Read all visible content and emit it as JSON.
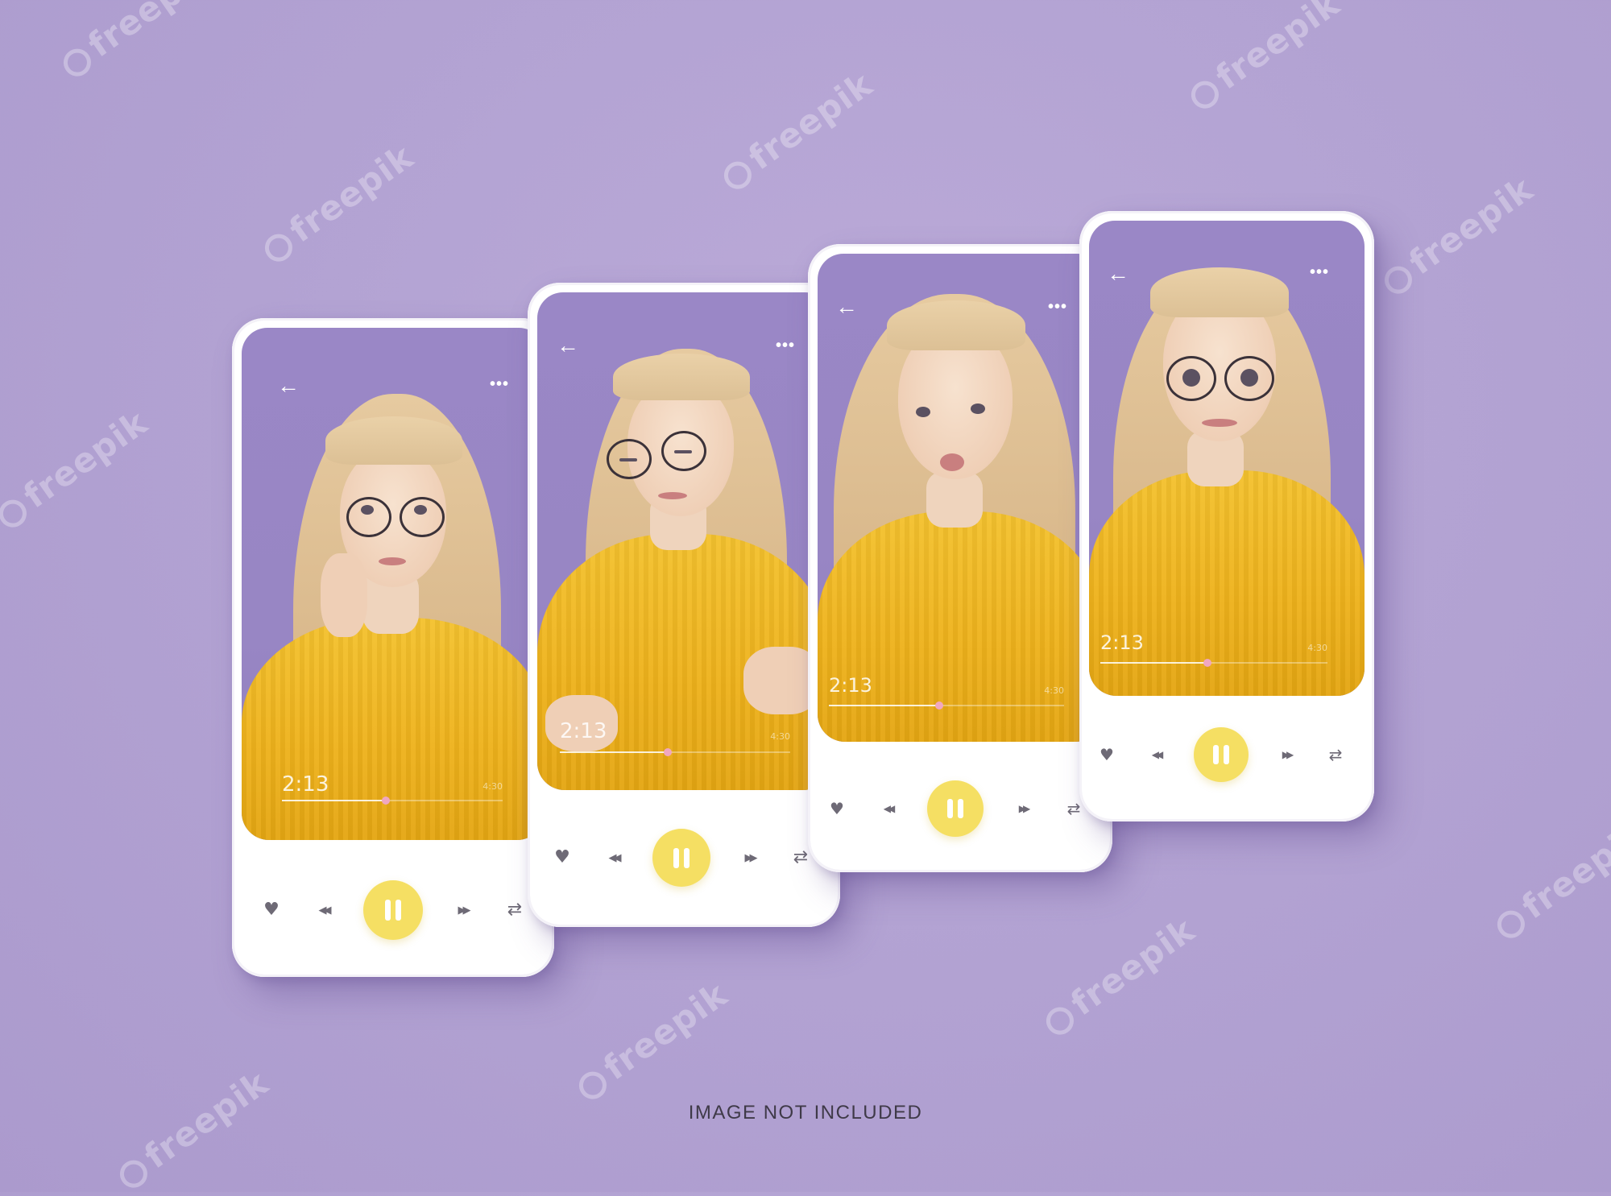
{
  "caption": "IMAGE NOT INCLUDED",
  "watermark": "freepik",
  "colors": {
    "background": "#b3a3d3",
    "screen_backdrop": "#9886c4",
    "sweater": "#f0b820",
    "hair": "#dcc095",
    "play_button": "#f5df63",
    "progress_knob": "#f0a7c0",
    "control_icons": "#6e6a76"
  },
  "phones": [
    {
      "expression": "thinking",
      "back_icon": "←",
      "more_icon": "•••",
      "elapsed": "2:13",
      "total": "4:30",
      "progress": 0.47,
      "controls": {
        "like": "♥",
        "rewind": "◀◀",
        "forward": "▶▶",
        "repeat": "⇄"
      }
    },
    {
      "expression": "eyes-closed-smile",
      "back_icon": "←",
      "more_icon": "•••",
      "elapsed": "2:13",
      "total": "4:30",
      "progress": 0.47,
      "controls": {
        "like": "♥",
        "rewind": "◀◀",
        "forward": "▶▶",
        "repeat": "⇄"
      }
    },
    {
      "expression": "kiss",
      "back_icon": "←",
      "more_icon": "•••",
      "elapsed": "2:13",
      "total": "4:30",
      "progress": 0.47,
      "controls": {
        "like": "♥",
        "rewind": "◀◀",
        "forward": "▶▶",
        "repeat": "⇄"
      }
    },
    {
      "expression": "surprised",
      "back_icon": "←",
      "more_icon": "•••",
      "elapsed": "2:13",
      "total": "4:30",
      "progress": 0.47,
      "controls": {
        "like": "♥",
        "rewind": "◀◀",
        "forward": "▶▶",
        "repeat": "⇄"
      }
    }
  ]
}
